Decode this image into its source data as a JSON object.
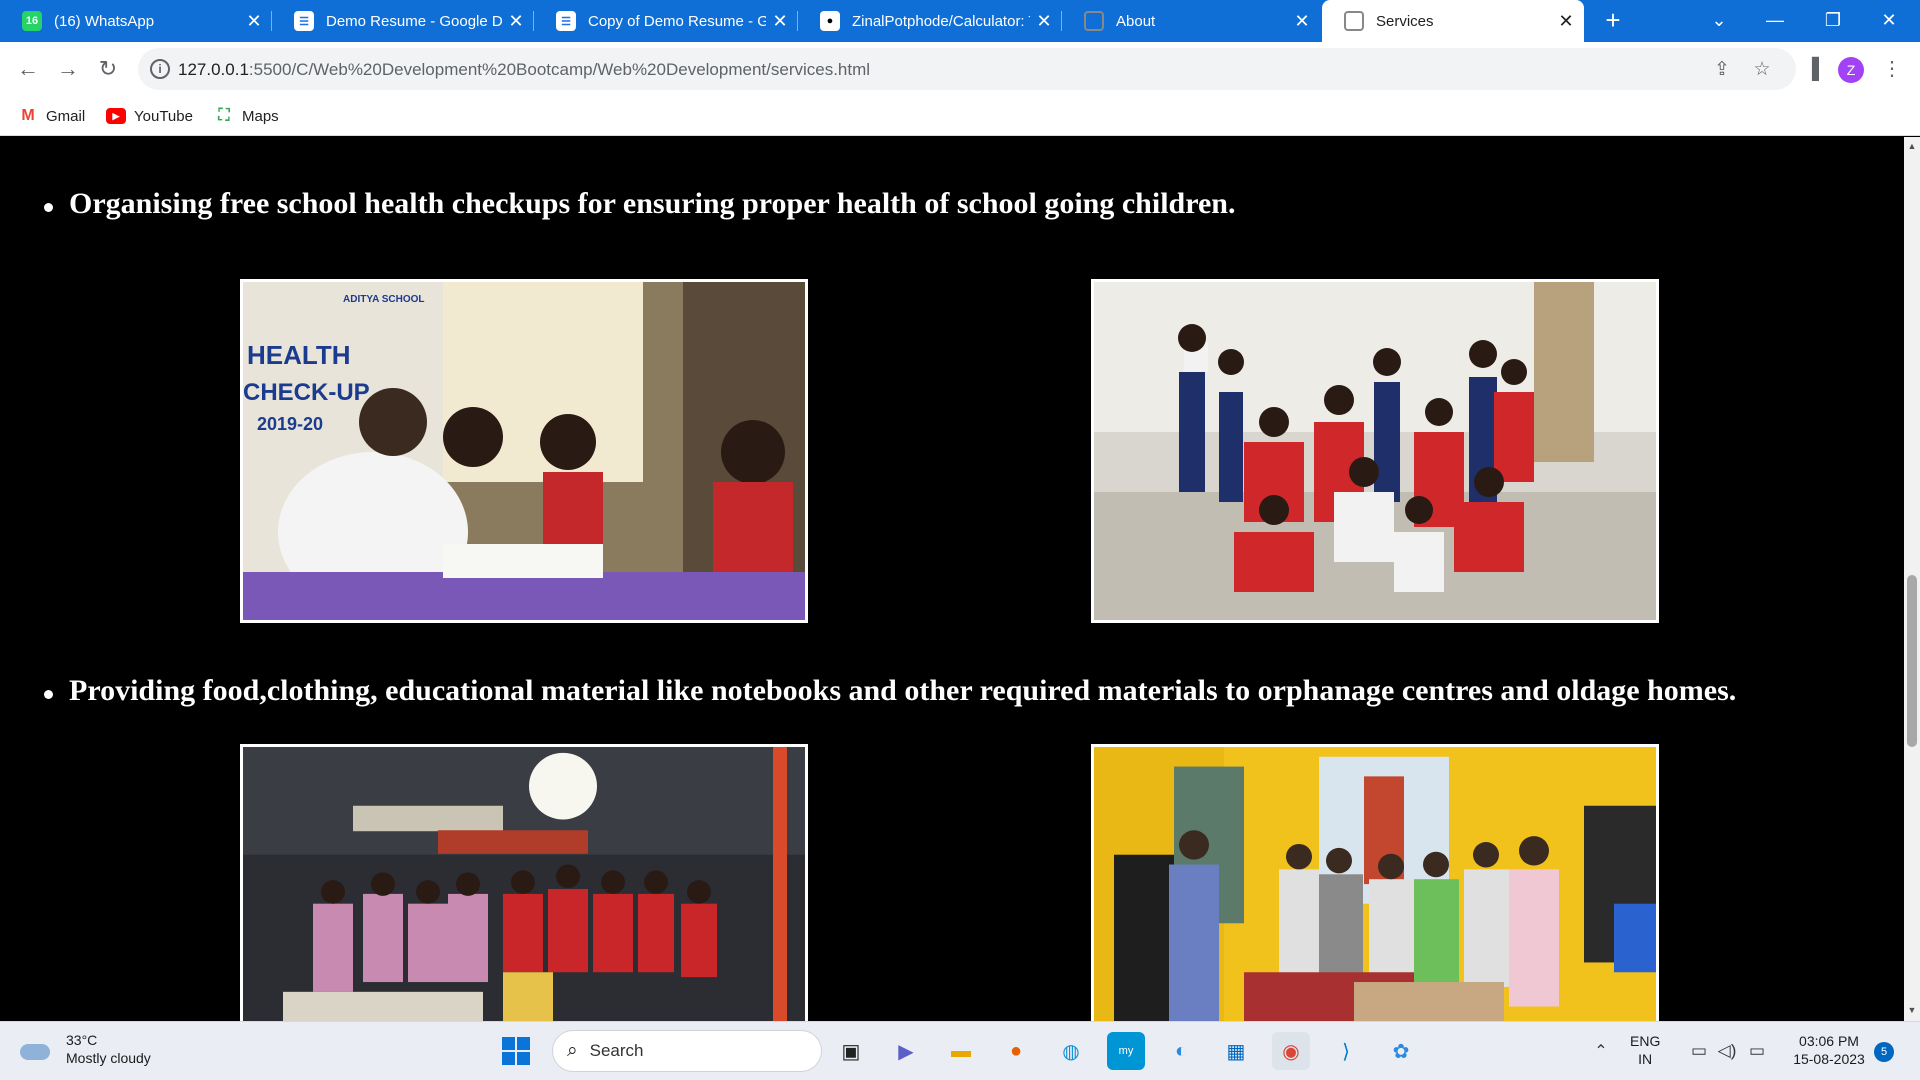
{
  "browser": {
    "tabs": [
      {
        "title": "(16) WhatsApp",
        "favicon": "whatsapp-icon"
      },
      {
        "title": "Demo Resume - Google Do",
        "favicon": "google-docs-icon"
      },
      {
        "title": "Copy of Demo Resume - Go",
        "favicon": "google-docs-icon"
      },
      {
        "title": "ZinalPotphode/Calculator: T",
        "favicon": "github-icon"
      },
      {
        "title": "About",
        "favicon": "globe-icon"
      },
      {
        "title": "Services",
        "favicon": "globe-icon",
        "active": true
      }
    ],
    "whatsapp_badge": "16",
    "url_host": "127.0.0.1",
    "url_rest": ":5500/C/Web%20Development%20Bootcamp/Web%20Development/services.html",
    "profile_initial": "Z",
    "bookmarks": [
      "Gmail",
      "YouTube",
      "Maps"
    ]
  },
  "page": {
    "items": [
      "Organising free school health checkups for ensuring proper health of school going children.",
      "Providing food,clothing, educational material like notebooks and other required materials to orphanage centres and oldage homes."
    ],
    "photo_signs": {
      "health_1": "HEALTH",
      "health_2": "CHECK-UP",
      "health_3": "2019-20",
      "school": "ADITYA SCHOOL"
    }
  },
  "taskbar": {
    "temperature": "33°C",
    "condition": "Mostly cloudy",
    "search_label": "Search",
    "language": "ENG",
    "region": "IN",
    "time": "03:06 PM",
    "date": "15-08-2023",
    "notification_count": "5"
  },
  "colors": {
    "tabstrip": "#0f6fd6",
    "page_background": "#000000",
    "page_text": "#ffffff",
    "avatar": "#a142f4"
  }
}
